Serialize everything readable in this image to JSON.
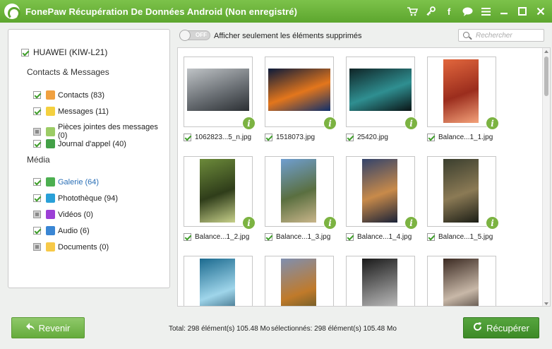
{
  "titlebar": {
    "title": "FonePaw Récupération De Données Android (Non enregistré)",
    "icons": [
      "cart-icon",
      "key-icon",
      "facebook-icon",
      "chat-icon",
      "menu-icon",
      "minimize-icon",
      "maximize-icon",
      "close-icon"
    ]
  },
  "device": {
    "name": "HUAWEI (KIW-L21)",
    "checked": true
  },
  "sections": [
    {
      "title": "Contacts & Messages",
      "items": [
        {
          "label": "Contacts (83)",
          "state": "on",
          "icon": "contacts-icon",
          "color": "#f0a040"
        },
        {
          "label": "Messages (11)",
          "state": "on",
          "icon": "messages-icon",
          "color": "#f4d03f"
        },
        {
          "label": "Pièces jointes des messages (0)",
          "state": "partial",
          "icon": "attachment-icon",
          "color": "#9ccc65"
        },
        {
          "label": "Journal d'appel (40)",
          "state": "on",
          "icon": "call-log-icon",
          "color": "#43a047"
        }
      ]
    },
    {
      "title": "Média",
      "items": [
        {
          "label": "Galerie (64)",
          "state": "on",
          "icon": "gallery-icon",
          "color": "#4caf50",
          "selected": true
        },
        {
          "label": "Photothèque (94)",
          "state": "on",
          "icon": "photo-library-icon",
          "color": "#29a0d8"
        },
        {
          "label": "Vidéos (0)",
          "state": "partial",
          "icon": "video-icon",
          "color": "#9c3fd6"
        },
        {
          "label": "Audio (6)",
          "state": "on",
          "icon": "audio-icon",
          "color": "#3a86d4"
        },
        {
          "label": "Documents (0)",
          "state": "partial",
          "icon": "documents-icon",
          "color": "#f7c948"
        }
      ]
    }
  ],
  "toolbar": {
    "toggle_text": "OFF",
    "filter_label": "Afficher seulement les éléments supprimés",
    "search_placeholder": "Rechercher"
  },
  "files": [
    {
      "name": "1062823...5_n.jpg",
      "orientation": "landscape",
      "palette": [
        "#bfc3c6",
        "#6b7075",
        "#2b2f33"
      ]
    },
    {
      "name": "1518073.jpg",
      "orientation": "landscape",
      "palette": [
        "#0b1a3a",
        "#e3761c",
        "#0e2f6b"
      ]
    },
    {
      "name": "25420.jpg",
      "orientation": "landscape",
      "palette": [
        "#0f2426",
        "#2f8f91",
        "#0a1415"
      ]
    },
    {
      "name": "Balance...1_1.jpg",
      "orientation": "portrait",
      "palette": [
        "#e2673d",
        "#9b2d1d",
        "#f4a27a"
      ]
    },
    {
      "name": "Balance...1_2.jpg",
      "orientation": "portrait",
      "palette": [
        "#6c8a3a",
        "#2f3d1a",
        "#c7d08a"
      ]
    },
    {
      "name": "Balance...1_3.jpg",
      "orientation": "portrait",
      "palette": [
        "#6f9ed0",
        "#5a6f40",
        "#c9b58a"
      ]
    },
    {
      "name": "Balance...1_4.jpg",
      "orientation": "portrait",
      "palette": [
        "#33436b",
        "#c88a4a",
        "#1a2238"
      ]
    },
    {
      "name": "Balance...1_5.jpg",
      "orientation": "portrait",
      "palette": [
        "#3a3e2e",
        "#8b7a55",
        "#1c1e16"
      ]
    },
    {
      "name": "",
      "orientation": "portrait",
      "palette": [
        "#1b6a8f",
        "#9fd5ea",
        "#0d3b55"
      ]
    },
    {
      "name": "",
      "orientation": "portrait",
      "palette": [
        "#7f8fb0",
        "#c07a2a",
        "#3c4a2a"
      ]
    },
    {
      "name": "",
      "orientation": "portrait",
      "palette": [
        "#1a1a1a",
        "#8a8a8a",
        "#e0e0e0"
      ]
    },
    {
      "name": "",
      "orientation": "portrait",
      "palette": [
        "#3b2a22",
        "#c8b8a8",
        "#1a120e"
      ]
    }
  ],
  "footer": {
    "back_label": "Revenir",
    "recover_label": "Récupérer",
    "total_text": "Total: 298 élément(s) 105.48 Mo",
    "selected_text": "sélectionnés: 298 élément(s) 105.48 Mo"
  }
}
